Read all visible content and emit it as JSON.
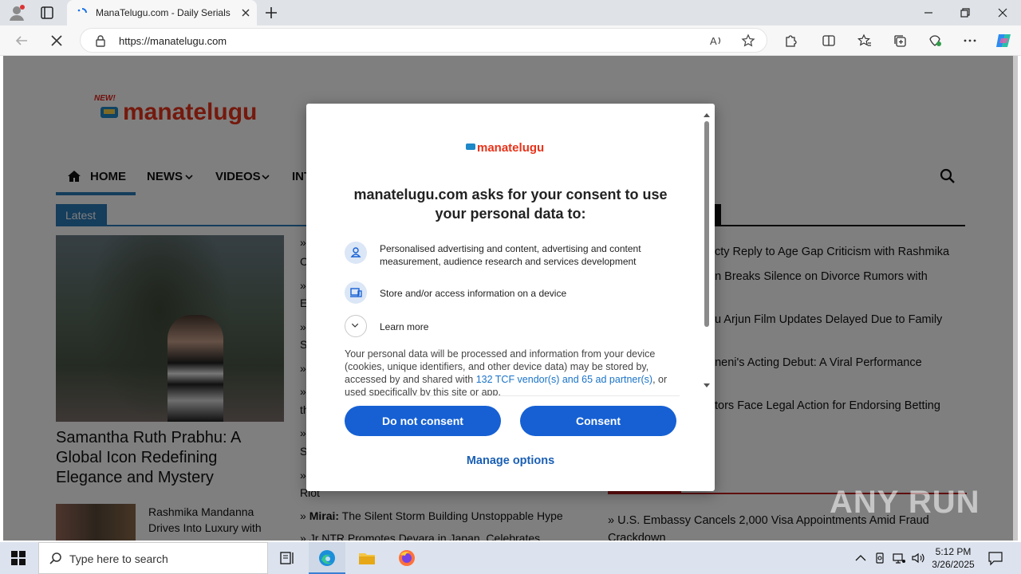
{
  "browser": {
    "tab_title": "ManaTelugu.com - Daily Serials |",
    "url": "https://manatelugu.com"
  },
  "site": {
    "logo_text": "manatelugu",
    "logo_badge": "NEW!",
    "nav": [
      "HOME",
      "NEWS",
      "VIDEOS",
      "INT"
    ],
    "latest_label": "Latest",
    "headline": "Samantha Ruth Prabhu: A Global Icon Redefining Elegance and Mystery",
    "thumb_headline": "Rashmika Mandanna Drives Into Luxury with",
    "mid_items": [
      {
        "bullet": "»",
        "text": "C"
      },
      {
        "bullet": "»",
        "text": "E"
      },
      {
        "bullet": "»",
        "text": "S"
      },
      {
        "bullet": "»",
        "text": ""
      },
      {
        "bullet": "»",
        "text": "th"
      },
      {
        "bullet": "»",
        "text": "S"
      },
      {
        "bullet": "»",
        "text": "Riot"
      },
      {
        "bullet": "»",
        "bold": "Mirai:",
        "text": "The Silent Storm Building Unstoppable Hype"
      },
      {
        "bullet": "»",
        "text": "Jr NTR Promotes Devara in Japan, Celebrates"
      }
    ],
    "right_items": [
      "cty Reply to Age Gap Criticism with Rashmika",
      "an Breaks Silence on Divorce Rumors with",
      "u Arjun Film Updates Delayed Due to Family",
      "aneni's Acting Debut: A Viral Performance",
      "tors Face Legal Action for Endorsing Betting"
    ],
    "bottom_right": "» U.S. Embassy Cancels 2,000 Visa Appointments Amid Fraud",
    "bottom_right2": "Crackdown"
  },
  "watermark": "ANY RUN",
  "consent": {
    "logo_text": "manatelugu",
    "title": "manatelugu.com asks for your consent to use your personal data to:",
    "purposes": [
      "Personalised advertising and content, advertising and content measurement, audience research and services development",
      "Store and/or access information on a device"
    ],
    "learn_more": "Learn more",
    "desc_1": "Your personal data will be processed and information from your device (cookies, unique identifiers, and other device data) may be stored by, accessed by and shared with ",
    "desc_link": "132 TCF vendor(s) and 65 ad partner(s)",
    "desc_2": ", or used specifically by this site or app.",
    "do_not_consent": "Do not consent",
    "consent_btn": "Consent",
    "manage": "Manage options",
    "primary_color": "#1660d3"
  },
  "taskbar": {
    "search_placeholder": "Type here to search",
    "time": "5:12 PM",
    "date": "3/26/2025"
  }
}
